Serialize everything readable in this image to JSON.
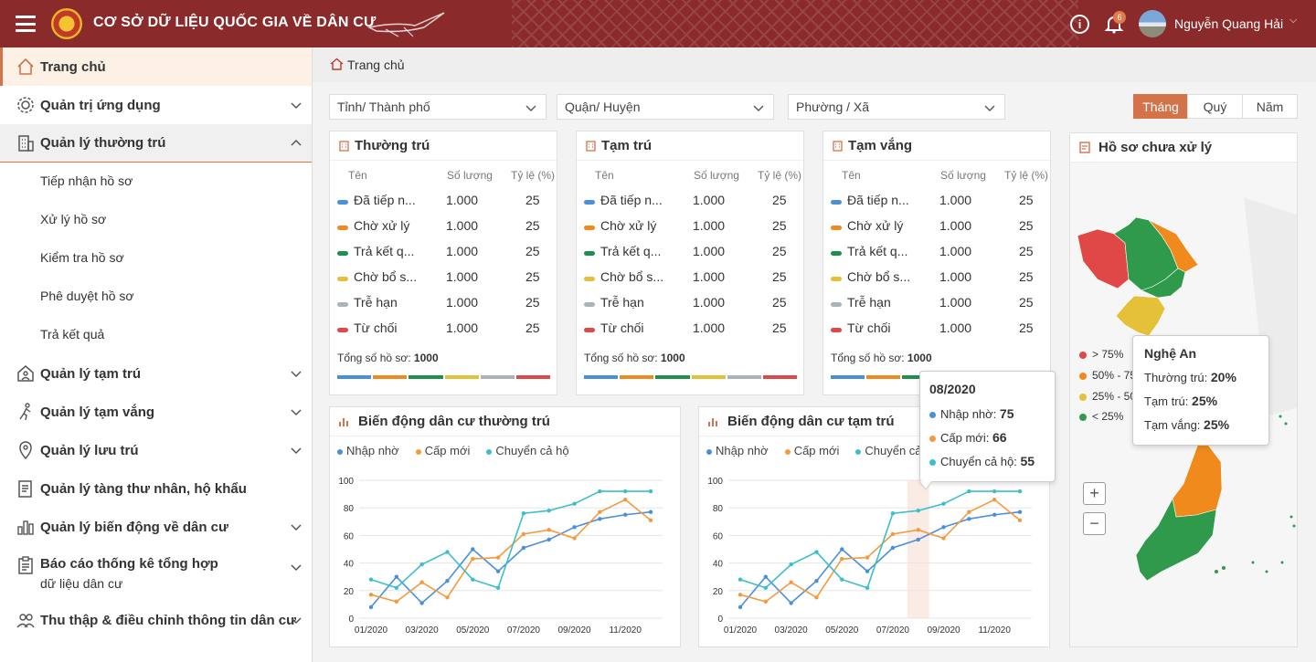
{
  "header": {
    "app_title": "CƠ SỞ DỮ LIỆU QUỐC GIA VỀ DÂN CƯ",
    "notification_count": "6",
    "user_name": "Nguyễn Quang Hải"
  },
  "sidebar": {
    "items": [
      {
        "label": "Trang chủ"
      },
      {
        "label": "Quản trị ứng dụng"
      },
      {
        "label": "Quản lý thường trú"
      },
      {
        "label": "Quản lý tạm trú"
      },
      {
        "label": "Quản lý tạm vắng"
      },
      {
        "label": "Quản lý lưu trú"
      },
      {
        "label": "Quản lý tàng thư nhân, hộ khẩu"
      },
      {
        "label": "Quản lý biến động về dân cư"
      },
      {
        "label": "Báo cáo thống kê tổng hợp",
        "label2": "dữ liệu dân cư"
      },
      {
        "label": "Thu thập & điều chỉnh thông tin dân cư"
      }
    ],
    "subitems": [
      "Tiếp nhận hồ sơ",
      "Xử lý hồ sơ",
      "Kiểm tra hồ sơ",
      "Phê duyệt hồ sơ",
      "Trả kết quả"
    ]
  },
  "breadcrumb": {
    "label": "Trang chủ"
  },
  "filters": {
    "province": "Tỉnh/ Thành phố",
    "district": "Quận/ Huyện",
    "ward": "Phường / Xã",
    "periods": [
      "Tháng",
      "Quý",
      "Năm"
    ]
  },
  "status_cards": {
    "columns": {
      "name": "Tên",
      "qty": "Số lượng",
      "pct": "Tỷ lệ (%)"
    },
    "rows": [
      {
        "name": "Đã tiếp n...",
        "qty": "1.000",
        "pct": "25",
        "color": "#4a90d9"
      },
      {
        "name": "Chờ xử lý",
        "qty": "1.000",
        "pct": "25",
        "color": "#f08a1c"
      },
      {
        "name": "Trả kết q...",
        "qty": "1.000",
        "pct": "25",
        "color": "#1f8f4e"
      },
      {
        "name": "Chờ bổ s...",
        "qty": "1.000",
        "pct": "25",
        "color": "#e5c13a"
      },
      {
        "name": "Trễ hạn",
        "qty": "1.000",
        "pct": "25",
        "color": "#a9b3ba"
      },
      {
        "name": "Từ chối",
        "qty": "1.000",
        "pct": "25",
        "color": "#e04848"
      }
    ],
    "total_label": "Tổng số hồ sơ:",
    "total_value": "1000",
    "cards": [
      {
        "title": "Thường trú"
      },
      {
        "title": "Tạm trú"
      },
      {
        "title": "Tạm vắng"
      }
    ]
  },
  "charts": {
    "permanent_title": "Biến động dân cư thường trú",
    "temporary_title": "Biến động dân cư tạm trú",
    "legend": [
      "Nhập nhờ",
      "Cấp mới",
      "Chuyển cả hộ"
    ],
    "series_colors": [
      "#4a90d9",
      "#f39a3e",
      "#3bbfc9"
    ]
  },
  "chart_data": [
    {
      "type": "line",
      "title": "Biến động dân cư thường trú",
      "x": [
        "01/2020",
        "02/2020",
        "03/2020",
        "04/2020",
        "05/2020",
        "06/2020",
        "07/2020",
        "08/2020",
        "09/2020",
        "10/2020",
        "11/2020",
        "12/2020"
      ],
      "x_tick_labels": [
        "01/2020",
        "03/2020",
        "05/2020",
        "07/2020",
        "09/2020",
        "11/2020"
      ],
      "ylim": [
        0,
        100
      ],
      "y_ticks": [
        0,
        20,
        40,
        60,
        80,
        100
      ],
      "series": [
        {
          "name": "Nhập nhờ",
          "values": [
            8,
            30,
            11,
            27,
            50,
            34,
            51,
            57,
            66,
            72,
            75,
            77
          ]
        },
        {
          "name": "Cấp mới",
          "values": [
            17,
            12,
            26,
            15,
            43,
            44,
            61,
            64,
            58,
            77,
            86,
            71
          ]
        },
        {
          "name": "Chuyển cả hộ",
          "values": [
            28,
            22,
            39,
            48,
            28,
            22,
            76,
            78,
            83,
            92,
            92,
            92
          ]
        }
      ]
    },
    {
      "type": "line",
      "title": "Biến động dân cư tạm trú",
      "x": [
        "01/2020",
        "02/2020",
        "03/2020",
        "04/2020",
        "05/2020",
        "06/2020",
        "07/2020",
        "08/2020",
        "09/2020",
        "10/2020",
        "11/2020",
        "12/2020"
      ],
      "x_tick_labels": [
        "01/2020",
        "03/2020",
        "05/2020",
        "07/2020",
        "09/2020",
        "11/2020"
      ],
      "ylim": [
        0,
        100
      ],
      "y_ticks": [
        0,
        20,
        40,
        60,
        80,
        100
      ],
      "series": [
        {
          "name": "Nhập nhờ",
          "values": [
            8,
            30,
            11,
            27,
            50,
            34,
            51,
            57,
            66,
            72,
            75,
            77
          ]
        },
        {
          "name": "Cấp mới",
          "values": [
            17,
            12,
            26,
            15,
            43,
            44,
            61,
            64,
            58,
            77,
            86,
            71
          ]
        },
        {
          "name": "Chuyển cả hộ",
          "values": [
            28,
            22,
            39,
            48,
            28,
            22,
            76,
            78,
            83,
            92,
            92,
            92
          ]
        }
      ],
      "highlight_index": 7
    }
  ],
  "chart_tooltip": {
    "date": "08/2020",
    "lines": [
      {
        "label": "Nhập nhờ:",
        "value": "75",
        "color": "#4a90d9"
      },
      {
        "label": "Cấp mới:",
        "value": "66",
        "color": "#f39a3e"
      },
      {
        "label": "Chuyển cả hộ:",
        "value": "55",
        "color": "#3bbfc9"
      }
    ]
  },
  "map": {
    "title": "Hồ sơ chưa xử lý",
    "legend": [
      {
        "label": "> 75%",
        "color": "#e04848"
      },
      {
        "label": "50% - 75",
        "color": "#f08a1c"
      },
      {
        "label": "25% - 50",
        "color": "#e5c13a"
      },
      {
        "label": "< 25%",
        "color": "#2f9a4c"
      }
    ],
    "tooltip": {
      "province": "Nghệ An",
      "lines": [
        {
          "label": "Thường trú:",
          "value": "20%"
        },
        {
          "label": "Tạm trú:",
          "value": "25%"
        },
        {
          "label": "Tạm vắng:",
          "value": "25%"
        }
      ]
    },
    "zoom_in": "+",
    "zoom_out": "−"
  }
}
